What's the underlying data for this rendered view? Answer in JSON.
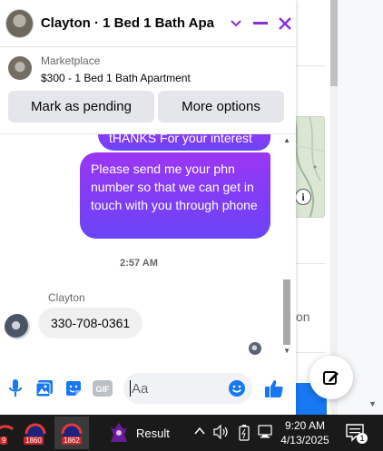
{
  "chat": {
    "header_title": "Clayton · 1 Bed 1 Bath Apa...",
    "listing": {
      "category": "Marketplace",
      "title": "$300 - 1 Bed 1 Bath Apartment",
      "mark_pending_label": "Mark as pending",
      "more_options_label": "More options"
    },
    "messages": {
      "partial_outgoing": "tHANKS For your interest",
      "outgoing": "Please send me your phn number so that we can get in touch with you through phone",
      "timestamp": "2:57 AM",
      "sender": "Clayton",
      "incoming": "330-708-0361"
    },
    "composer": {
      "placeholder": "Aa"
    }
  },
  "background": {
    "partial_text": "on"
  },
  "taskbar": {
    "badges": [
      "9",
      "1860",
      "1862"
    ],
    "result_label": "Result",
    "time": "9:20 AM",
    "date": "4/13/2025",
    "notification_count": "1"
  },
  "colors": {
    "accent": "#8a2be2",
    "bubble_gradient_start": "#9b36f3",
    "bubble_gradient_end": "#6b44f7",
    "like_blue": "#1877f2"
  }
}
